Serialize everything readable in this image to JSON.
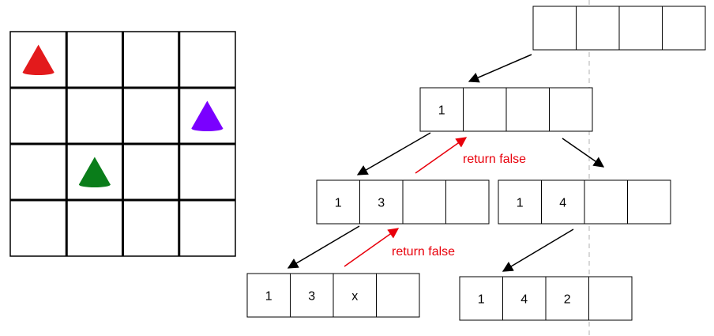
{
  "board": {
    "rows": 4,
    "cols": 4,
    "pieces": [
      {
        "row": 0,
        "col": 0,
        "color": "#e31a1c",
        "icon": "red-cone-icon"
      },
      {
        "row": 1,
        "col": 3,
        "color": "#7a00ff",
        "icon": "purple-cone-icon"
      },
      {
        "row": 2,
        "col": 1,
        "color": "#0a7d1a",
        "icon": "green-cone-icon"
      }
    ]
  },
  "tree": {
    "nodes": [
      {
        "id": "root",
        "cells": [
          "",
          "",
          "",
          ""
        ]
      },
      {
        "id": "n1",
        "cells": [
          "1",
          "",
          "",
          ""
        ]
      },
      {
        "id": "n13",
        "cells": [
          "1",
          "3",
          "",
          ""
        ]
      },
      {
        "id": "n14",
        "cells": [
          "1",
          "4",
          "",
          ""
        ]
      },
      {
        "id": "n13x",
        "cells": [
          "1",
          "3",
          "x",
          ""
        ]
      },
      {
        "id": "n142",
        "cells": [
          "1",
          "4",
          "2",
          ""
        ]
      }
    ],
    "labels": {
      "return_false_upper": "return false",
      "return_false_lower": "return false"
    }
  },
  "colors": {
    "line": "#000000",
    "backtrack_arrow": "#e8000b",
    "divider": "#b0b0b0"
  }
}
